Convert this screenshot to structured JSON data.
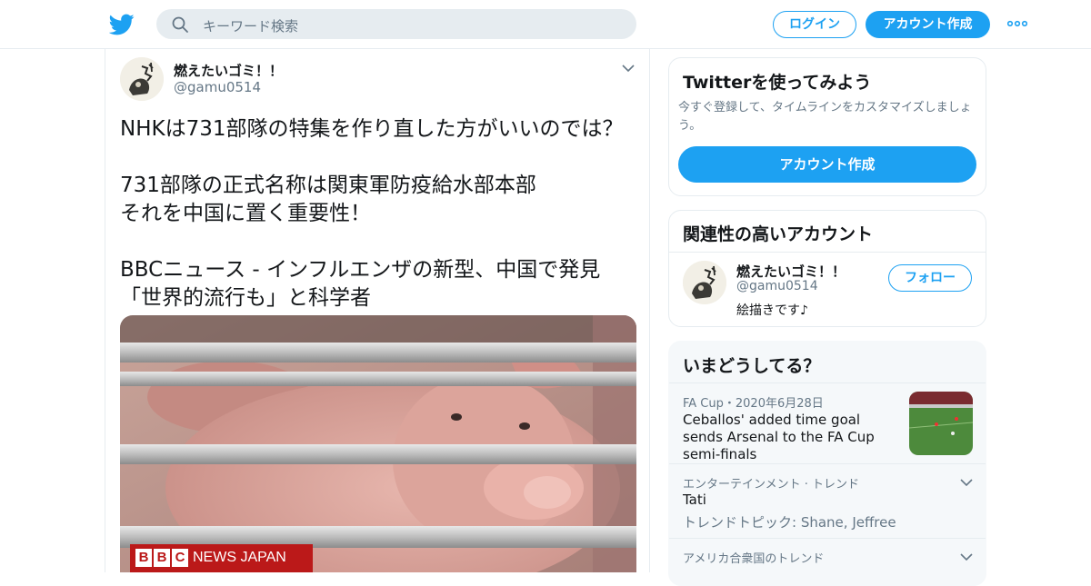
{
  "header": {
    "search_placeholder": "キーワード検索",
    "login_label": "ログイン",
    "signup_label": "アカウント作成",
    "brand_color": "#1da1f2"
  },
  "tweet": {
    "display_name": "燃えたいゴミ！！",
    "handle": "@gamu0514",
    "text": "NHKは731部隊の特集を作り直した方がいいのでは？\n\n731部隊の正式名称は関東軍防疫給水部本部\nそれを中国に置く重要性！\n\nBBCニュース - インフルエンザの新型、中国で発見\n「世界的流行も」と科学者",
    "image_logo": {
      "bbc": "BBC",
      "text": "NEWS JAPAN"
    }
  },
  "sidebar": {
    "signup_card": {
      "title": "Twitterを使ってみよう",
      "description": "今すぐ登録して、タイムラインをカスタマイズしましょう。",
      "button": "アカウント作成"
    },
    "related": {
      "title": "関連性の高いアカウント",
      "account": {
        "name": "燃えたいゴミ！！",
        "handle": "@gamu0514",
        "bio": "絵描きです♪",
        "follow_label": "フォロー"
      }
    },
    "trends": {
      "title": "いまどうしてる？",
      "items": [
        {
          "meta": "FA Cup・2020年6月28日",
          "title": "Ceballos' added time goal sends Arsenal to the FA Cup semi-finals"
        },
        {
          "meta": "エンターテインメント · トレンド",
          "title": "Tati",
          "sub": "トレンドトピック: Shane, Jeffree"
        },
        {
          "meta": "アメリカ合衆国のトレンド"
        }
      ]
    }
  }
}
